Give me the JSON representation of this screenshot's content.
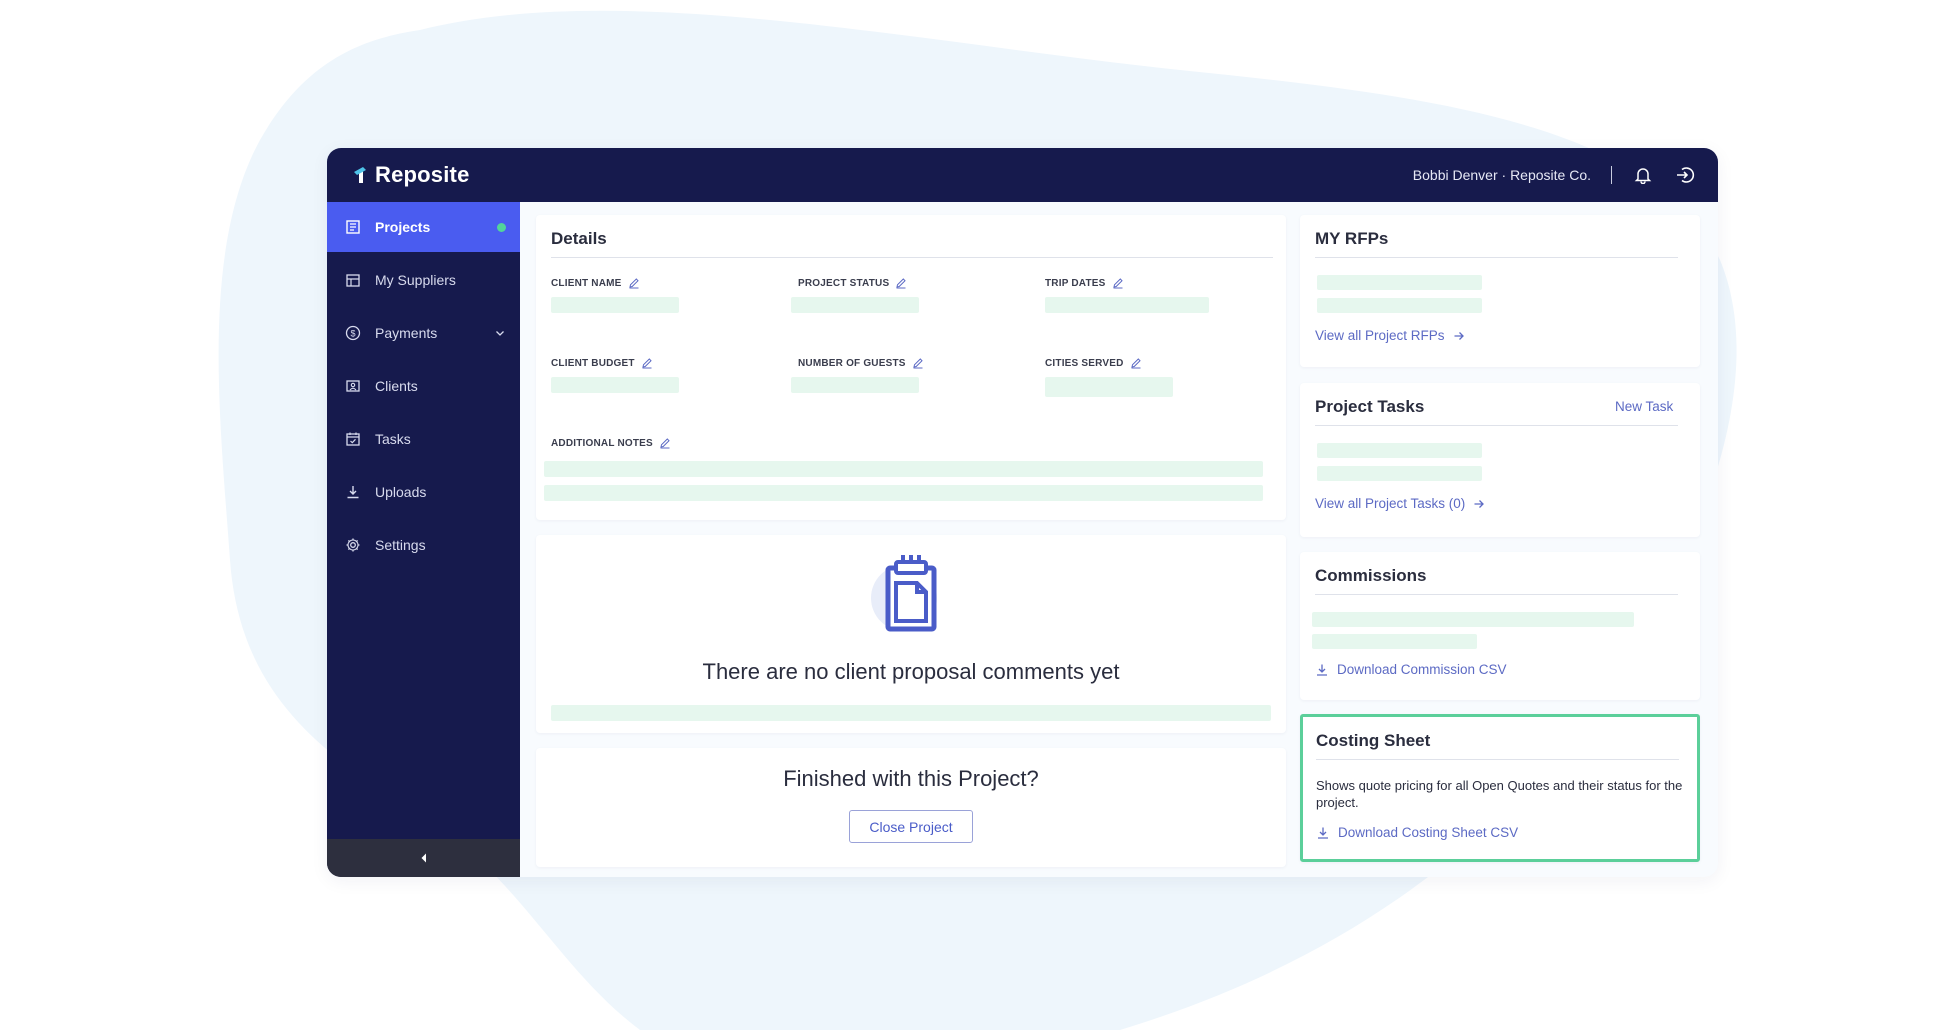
{
  "brand": {
    "name": "Reposite"
  },
  "topbar": {
    "user": "Bobbi Denver · Reposite Co."
  },
  "sidebar": {
    "items": [
      {
        "label": "Projects",
        "icon": "projects-icon",
        "active": true
      },
      {
        "label": "My Suppliers",
        "icon": "suppliers-icon"
      },
      {
        "label": "Payments",
        "icon": "dollar-icon"
      },
      {
        "label": "Clients",
        "icon": "clients-icon"
      },
      {
        "label": "Tasks",
        "icon": "tasks-icon"
      },
      {
        "label": "Uploads",
        "icon": "upload-icon"
      },
      {
        "label": "Settings",
        "icon": "gear-icon"
      }
    ]
  },
  "details": {
    "title": "Details",
    "fields": {
      "client_name": "CLIENT NAME",
      "project_status": "PROJECT STATUS",
      "trip_dates": "TRIP DATES",
      "client_budget": "CLIENT BUDGET",
      "number_of_guests": "NUMBER OF GUESTS",
      "cities_served": "CITIES SERVED",
      "additional_notes": "ADDITIONAL NOTES"
    }
  },
  "comments": {
    "empty_message": "There are no client proposal comments yet"
  },
  "finish": {
    "message": "Finished with this Project?",
    "button_label": "Close Project"
  },
  "rfps": {
    "title": "MY RFPs",
    "link": "View all Project RFPs"
  },
  "tasks": {
    "title": "Project Tasks",
    "new_task": "New Task",
    "link": "View all Project Tasks (0)"
  },
  "commissions": {
    "title": "Commissions",
    "link": "Download Commission CSV"
  },
  "costing": {
    "title": "Costing Sheet",
    "description": "Shows quote pricing for all Open Quotes and their status for the project.",
    "link": "Download Costing Sheet CSV"
  },
  "colors": {
    "navy": "#161a4d",
    "accent": "#4a5cf0",
    "skeleton": "#e6f7ee",
    "highlight": "#5bcf9a",
    "link": "#5c6ac4"
  }
}
